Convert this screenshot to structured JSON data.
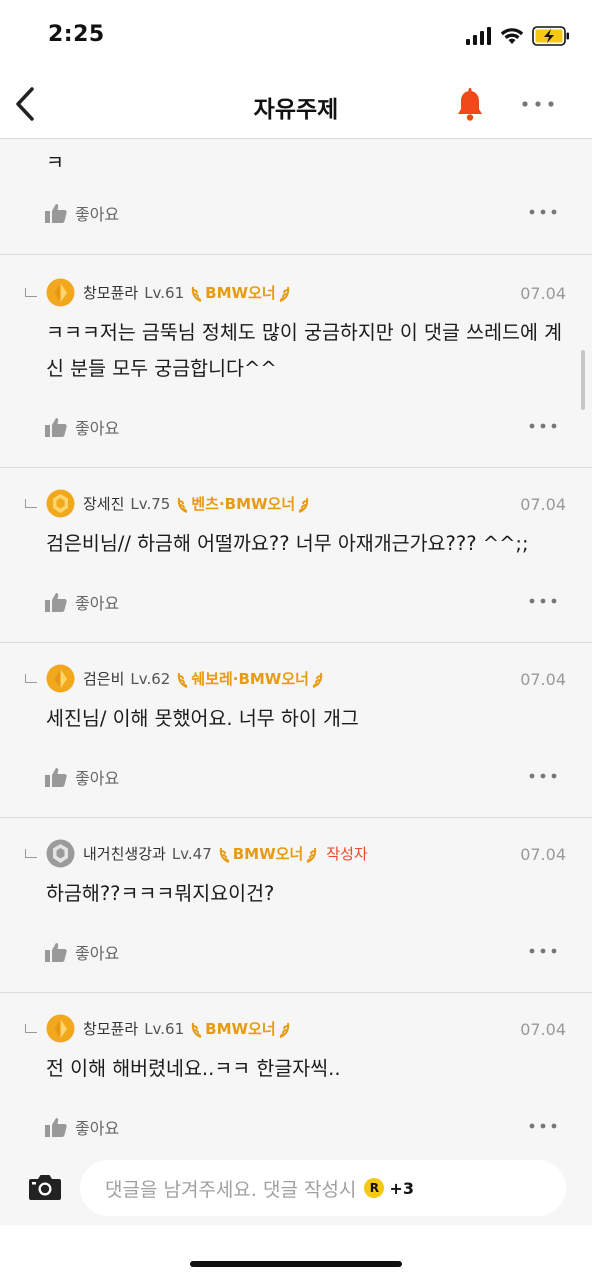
{
  "status_bar": {
    "time": "2:25"
  },
  "nav": {
    "title": "자유주제"
  },
  "first_comment": {
    "text": "ㅋ",
    "like_label": "좋아요"
  },
  "comments": [
    {
      "author": "창모퓬라",
      "level": "Lv.61",
      "badge": "BMW오너",
      "date": "07.04",
      "text": "ㅋㅋㅋ저는 금뚝님 정체도 많이 궁금하지만 이 댓글 쓰레드에 계신 분들 모두 궁금합니다^^",
      "like_label": "좋아요"
    },
    {
      "author": "장세진",
      "level": "Lv.75",
      "badge": "벤츠·BMW오너",
      "date": "07.04",
      "text": "검은비님// 하금해 어떨까요?? 너무 아재개근가요??? ^^;;",
      "like_label": "좋아요"
    },
    {
      "author": "검은비",
      "level": "Lv.62",
      "badge": "쉐보레·BMW오너",
      "date": "07.04",
      "text": "세진님/ 이해 못했어요. 너무 하이 개그",
      "like_label": "좋아요"
    },
    {
      "author": "내거친생강과",
      "level": "Lv.47",
      "badge": "BMW오너",
      "author_tag": "작성자",
      "date": "07.04",
      "text": "하금해??ㅋㅋㅋ뭐지요이건?",
      "like_label": "좋아요"
    },
    {
      "author": "창모퓬라",
      "level": "Lv.61",
      "badge": "BMW오너",
      "date": "07.04",
      "text": "전 이해 해버렸네요..ㅋㅋ 한글자씩..",
      "like_label": "좋아요"
    }
  ],
  "compose": {
    "placeholder": "댓글을 남겨주세요. 댓글 작성시",
    "reward_icon": "R",
    "reward_points": "+3"
  },
  "colors": {
    "accent_badge": "#e89a12",
    "author_tag": "#ea4a2a",
    "bell": "#f04a1a",
    "reward": "#f6c812"
  }
}
